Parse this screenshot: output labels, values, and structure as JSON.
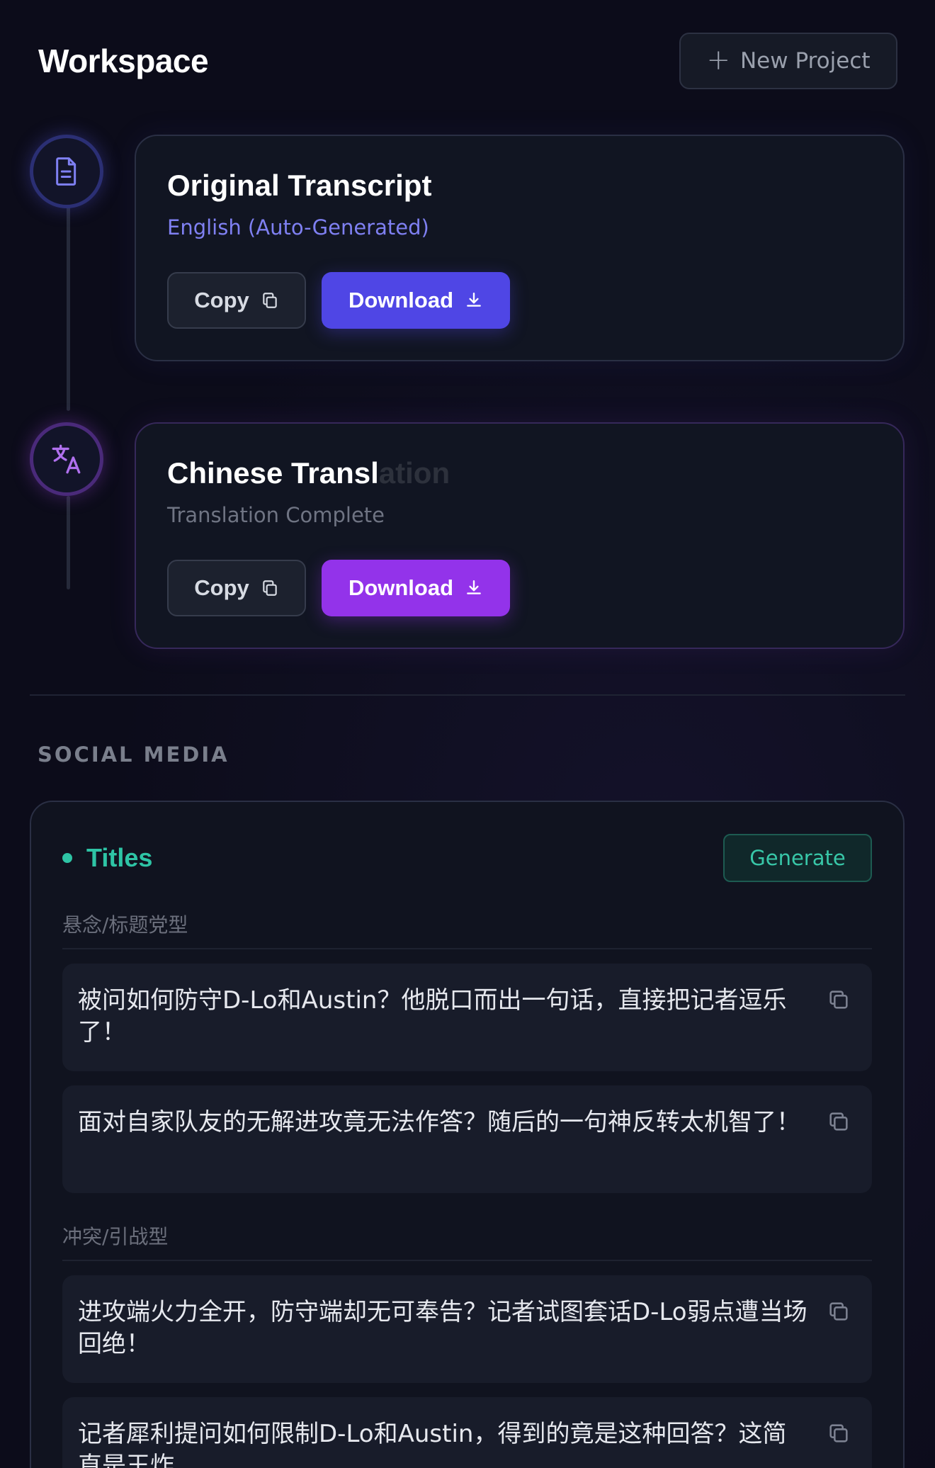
{
  "header": {
    "title": "Workspace",
    "new_project_label": "New Project"
  },
  "transcripts": [
    {
      "title": "Original Transcript",
      "subtitle": "English (Auto-Generated)",
      "copy_label": "Copy",
      "download_label": "Download",
      "accent": "#4f46e5",
      "icon": "document-icon"
    },
    {
      "title_visible": "Chinese Transl",
      "title_faded": "ation",
      "subtitle": "Translation Complete",
      "copy_label": "Copy",
      "download_label": "Download",
      "accent": "#9333ea",
      "icon": "translate-icon"
    }
  ],
  "social": {
    "section_label": "SOCIAL MEDIA",
    "titles_label": "Titles",
    "generate_label": "Generate",
    "accent": "#2ec4a5",
    "groups": [
      {
        "label": "悬念/标题党型",
        "items": [
          "被问如何防守D-Lo和Austin？他脱口而出一句话，直接把记者逗乐了！",
          "面对自家队友的无解进攻竟无法作答？随后的一句神反转太机智了！"
        ]
      },
      {
        "label": "冲突/引战型",
        "items": [
          "进攻端火力全开，防守端却无可奉告？记者试图套话D-Lo弱点遭当场回绝！",
          "记者犀利提问如何限制D-Lo和Austin，得到的竟是这种回答？这简直是王炸"
        ]
      }
    ]
  }
}
